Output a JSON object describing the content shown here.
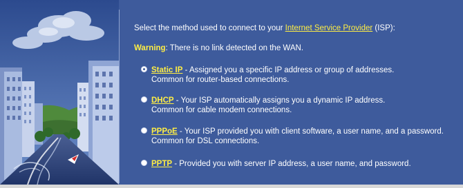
{
  "intro": {
    "before": "Select the method used to connect to your ",
    "link": "Internet Service Provider",
    "after": " (ISP):"
  },
  "warning": {
    "label": "Warning",
    "text": ": There is no link detected on the WAN."
  },
  "options": [
    {
      "name": "Static IP",
      "line1": " - Assigned you a specific IP address or group of addresses.",
      "line2": "Common for router-based connections.",
      "checked": true
    },
    {
      "name": "DHCP",
      "line1": " - Your ISP automatically assigns you a dynamic IP address.",
      "line2": "Common for cable modem connections.",
      "checked": false
    },
    {
      "name": "PPPoE",
      "line1": " - Your ISP provided you with client software, a user name, and a password.",
      "line2": "Common for DSL connections.",
      "checked": false
    },
    {
      "name": "PPTP",
      "line1": " - Provided you with server IP address, a user name, and password.",
      "line2": "",
      "checked": false
    }
  ]
}
